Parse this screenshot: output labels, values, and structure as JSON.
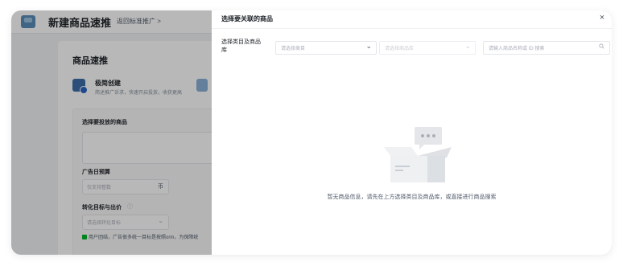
{
  "background": {
    "header": {
      "title": "新建商品速推",
      "back_link": "返回标准推广 >"
    },
    "main": {
      "section_title": "商品速推",
      "quick_create": {
        "label": "极简创建",
        "description": "简述推广诉求，快速开启投放，收获更高"
      },
      "product_label": "选择要投放的商品",
      "budget_label": "广告日预算",
      "budget_placeholder": "仅支持整数",
      "budget_unit": "币",
      "goal_label": "转化目标与出价",
      "goal_help_icon": "question-circle-icon",
      "goal_placeholder": "请选择转化目标",
      "notice": "用户团结，广告很多统一目标是按照orm，为保障统"
    }
  },
  "drawer": {
    "title": "选择要关联的商品",
    "close_icon": "×",
    "filter_label": "选择类目及商品库",
    "category_select": {
      "placeholder": "请选择类目",
      "icon": "chevron-down-icon"
    },
    "library_select": {
      "placeholder": "请选择商品库",
      "icon": "chevron-down-icon"
    },
    "search": {
      "placeholder": "请输入商品名称或 ID 搜索",
      "icon": "search-icon"
    },
    "empty_state": {
      "illustration": "empty-box-illustration",
      "message": "暂无商品信息，请先在上方选择类目及商品库，或直接进行商品搜索"
    }
  }
}
